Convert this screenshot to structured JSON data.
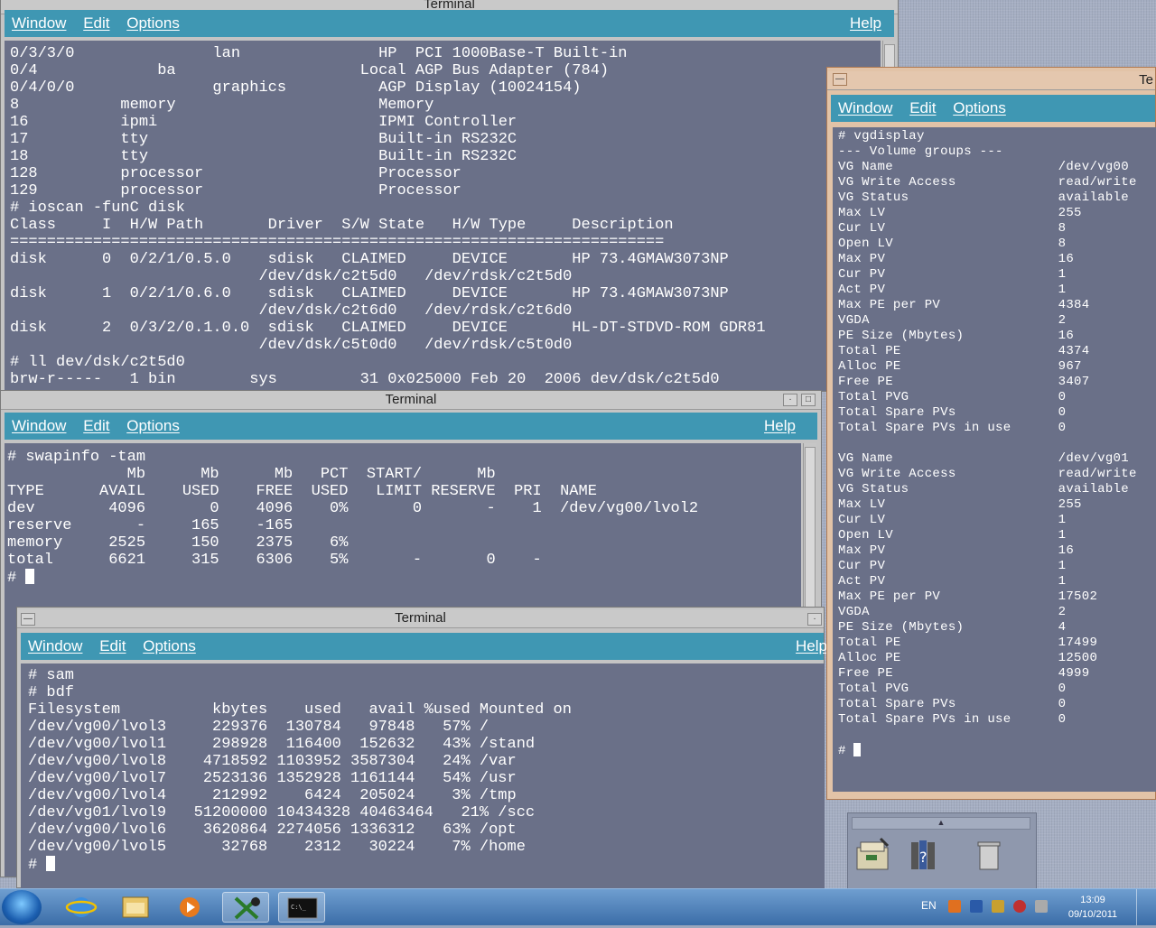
{
  "taskbar": {
    "language": "EN",
    "time": "13:09",
    "date": "09/10/2011"
  },
  "windows": {
    "top": {
      "title": "Terminal",
      "menu": [
        "Window",
        "Edit",
        "Options"
      ],
      "help": "Help",
      "content": "0/3/3/0               lan               HP  PCI 1000Base-T Built-in\n0/4             ba                    Local AGP Bus Adapter (784)\n0/4/0/0               graphics          AGP Display (10024154)\n8           memory                      Memory\n16          ipmi                        IPMI Controller\n17          tty                         Built-in RS232C\n18          tty                         Built-in RS232C\n128         processor                   Processor\n129         processor                   Processor\n# ioscan -funC disk\nClass     I  H/W Path       Driver  S/W State   H/W Type     Description\n=======================================================================\ndisk      0  0/2/1/0.5.0    sdisk   CLAIMED     DEVICE       HP 73.4GMAW3073NP\n                           /dev/dsk/c2t5d0   /dev/rdsk/c2t5d0\ndisk      1  0/2/1/0.6.0    sdisk   CLAIMED     DEVICE       HP 73.4GMAW3073NP\n                           /dev/dsk/c2t6d0   /dev/rdsk/c2t6d0\ndisk      2  0/3/2/0.1.0.0  sdisk   CLAIMED     DEVICE       HL-DT-STDVD-ROM GDR81\n                           /dev/dsk/c5t0d0   /dev/rdsk/c5t0d0\n# ll dev/dsk/c2t5d0\nbrw-r-----   1 bin        sys         31 0x025000 Feb 20  2006 dev/dsk/c2t5d0"
    },
    "swap": {
      "title": "Terminal",
      "menu": [
        "Window",
        "Edit",
        "Options"
      ],
      "help": "Help",
      "content": "# swapinfo -tam\n             Mb      Mb      Mb   PCT  START/      Mb\nTYPE      AVAIL    USED    FREE  USED   LIMIT RESERVE  PRI  NAME\ndev        4096       0    4096    0%       0       -    1  /dev/vg00/lvol2\nreserve       -     165    -165\nmemory     2525     150    2375    6%\ntotal      6621     315    6306    5%       -       0    -\n# "
    },
    "bdf": {
      "title": "Terminal",
      "menu": [
        "Window",
        "Edit",
        "Options"
      ],
      "help": "Help",
      "content": "# sam\n# bdf\nFilesystem          kbytes    used   avail %used Mounted on\n/dev/vg00/lvol3     229376  130784   97848   57% /\n/dev/vg00/lvol1     298928  116400  152632   43% /stand\n/dev/vg00/lvol8    4718592 1103952 3587304   24% /var\n/dev/vg00/lvol7    2523136 1352928 1161144   54% /usr\n/dev/vg00/lvol4     212992    6424  205024    3% /tmp\n/dev/vg01/lvol9   51200000 10434328 40463464   21% /scc\n/dev/vg00/lvol6    3620864 2274056 1336312   63% /opt\n/dev/vg00/lvol5      32768    2312   30224    7% /home\n# "
    },
    "vg": {
      "title": "Te",
      "menu": [
        "Window",
        "Edit",
        "Options"
      ],
      "content": "# vgdisplay\n--- Volume groups ---\nVG Name                     /dev/vg00\nVG Write Access             read/write\nVG Status                   available\nMax LV                      255\nCur LV                      8\nOpen LV                     8\nMax PV                      16\nCur PV                      1\nAct PV                      1\nMax PE per PV               4384\nVGDA                        2\nPE Size (Mbytes)            16\nTotal PE                    4374\nAlloc PE                    967\nFree PE                     3407\nTotal PVG                   0\nTotal Spare PVs             0\nTotal Spare PVs in use      0\n\nVG Name                     /dev/vg01\nVG Write Access             read/write\nVG Status                   available\nMax LV                      255\nCur LV                      1\nOpen LV                     1\nMax PV                      16\nCur PV                      1\nAct PV                      1\nMax PE per PV               17502\nVGDA                        2\nPE Size (Mbytes)            4\nTotal PE                    17499\nAlloc PE                    12500\nFree PE                     4999\nTotal PVG                   0\nTotal Spare PVs             0\nTotal Spare PVs in use      0\n\n# "
    }
  }
}
